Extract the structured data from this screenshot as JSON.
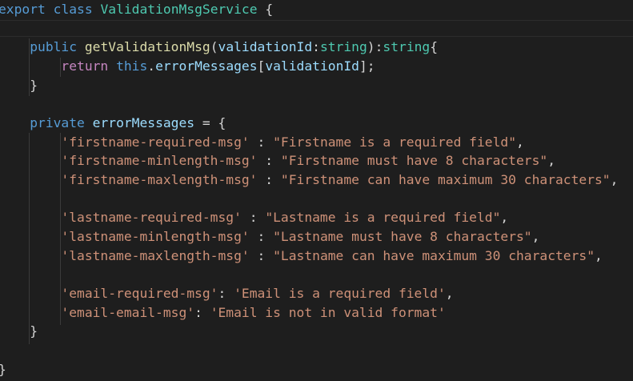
{
  "editor": {
    "theme_colors": {
      "background": "#1e1e1e",
      "keyword": "#569cd6",
      "control": "#c586c0",
      "class": "#4ec9b0",
      "function": "#dcdcaa",
      "variable": "#9cdcfe",
      "string": "#ce9178",
      "text": "#d4d4d4"
    },
    "code": {
      "l1": {
        "kw1": "export",
        "kw2": "class",
        "cls": "ValidationMsgService",
        "brace": "{"
      },
      "l3": {
        "kw": "public",
        "fn": "getValidationMsg",
        "p1": "(",
        "param": "validationId",
        "colon": ":",
        "type1": "string",
        "p2": "):",
        "type2": "string",
        "brace": "{"
      },
      "l4": {
        "kw": "return",
        "this": "this",
        "dot": ".",
        "prop": "errorMessages",
        "b1": "[",
        "idx": "validationId",
        "b2": "];"
      },
      "l5": {
        "brace": "}"
      },
      "l7": {
        "kw": "private",
        "prop": "errorMessages",
        "eq": "=",
        "brace": "{"
      },
      "l8": {
        "key": "'firstname-required-msg'",
        "sep": ":",
        "val": "\"Firstname is a required field\"",
        "comma": ","
      },
      "l9": {
        "key": "'firstname-minlength-msg'",
        "sep": ":",
        "val": "\"Firstname must have 8 characters\"",
        "comma": ","
      },
      "l10": {
        "key": "'firstname-maxlength-msg'",
        "sep": ":",
        "val": "\"Firstname can have maximum 30 characters\"",
        "comma": ","
      },
      "l12": {
        "key": "'lastname-required-msg'",
        "sep": ":",
        "val": "\"Lastname is a required field\"",
        "comma": ","
      },
      "l13": {
        "key": "'lastname-minlength-msg'",
        "sep": ":",
        "val": "\"Lastname must have 8 characters\"",
        "comma": ","
      },
      "l14": {
        "key": "'lastname-maxlength-msg'",
        "sep": ":",
        "val": "\"Lastname can have maximum 30 characters\"",
        "comma": ","
      },
      "l16": {
        "key": "'email-required-msg'",
        "sep": ":",
        "val": "'Email is a required field'",
        "comma": ","
      },
      "l17": {
        "key": "'email-email-msg'",
        "sep": ":",
        "val": "'Email is not in valid format'"
      },
      "l18": {
        "brace": "}"
      },
      "l20": {
        "brace": "}"
      }
    }
  }
}
